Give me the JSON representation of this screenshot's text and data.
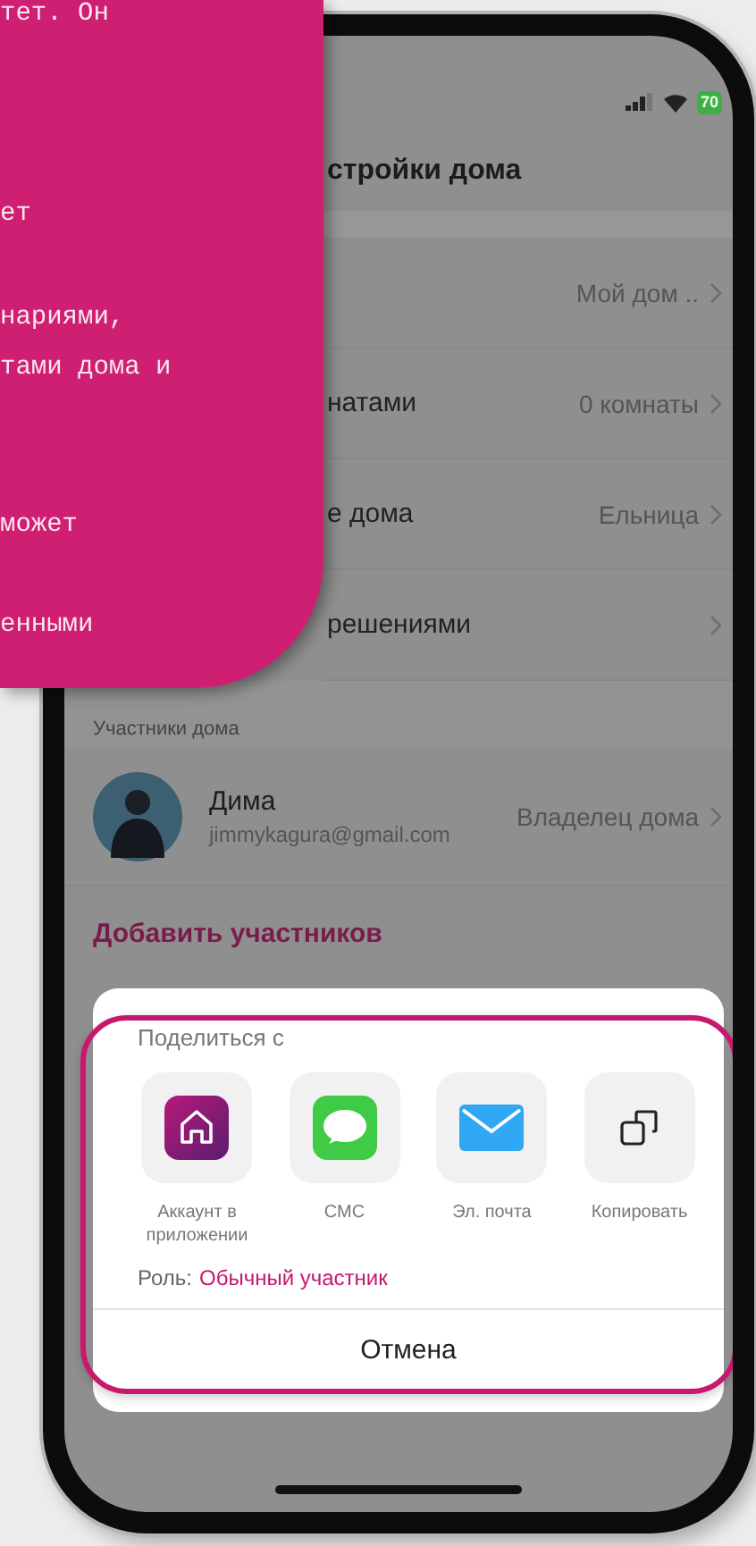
{
  "callout": {
    "paragraphs": [
      [
        "тет. Он"
      ],
      [
        "ет"
      ],
      [
        "нариями,",
        "тами дома и"
      ],
      [
        "может"
      ],
      [
        "енными"
      ]
    ]
  },
  "status_bar": {
    "battery": "70"
  },
  "header": {
    "title": "стройки дома"
  },
  "settings_rows": [
    {
      "value": "Мой дом .."
    },
    {
      "label": "натами",
      "value": "0 комнаты"
    },
    {
      "label": "е дома",
      "value": "Ельница"
    },
    {
      "label": "решениями"
    }
  ],
  "members": {
    "header": "Участники дома",
    "items": [
      {
        "name": "Дима",
        "email": "jimmykagura@gmail.com",
        "role": "Владелец дома"
      }
    ],
    "add_button": "Добавить участников"
  },
  "share_sheet": {
    "highlighted": true,
    "title": "Поделиться с",
    "targets": [
      {
        "kind": "app",
        "label": "Аккаунт в приложении"
      },
      {
        "kind": "sms",
        "label": "СМС"
      },
      {
        "kind": "mail",
        "label": "Эл. почта"
      },
      {
        "kind": "copy",
        "label": "Копировать"
      }
    ],
    "role_label": "Роль:",
    "role_value": "Обычный участник",
    "cancel": "Отмена"
  }
}
